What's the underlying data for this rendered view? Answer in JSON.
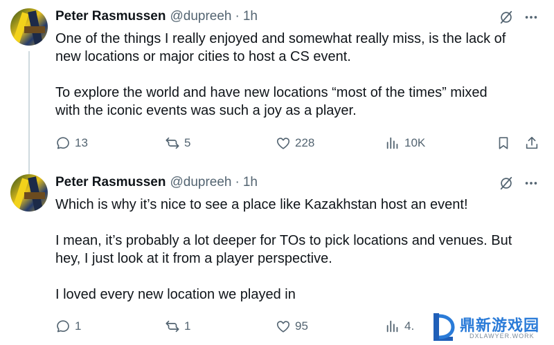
{
  "tweets": [
    {
      "name": "Peter Rasmussen",
      "handle": "@dupreeh",
      "separator": "·",
      "time": "1h",
      "lines": [
        "One of the things I really enjoyed and somewhat really miss, is the lack of",
        "new locations or major cities to host a CS event.",
        "",
        "To explore the world and have new locations “most of the times” mixed",
        "with the iconic events was such a joy as a player."
      ],
      "replies": "13",
      "reposts": "5",
      "likes": "228",
      "views": "10K"
    },
    {
      "name": "Peter Rasmussen",
      "handle": "@dupreeh",
      "separator": "·",
      "time": "1h",
      "lines": [
        "Which is why it’s nice to see a place like Kazakhstan host an event!",
        "",
        "I mean, it’s probably a lot deeper for TOs to pick locations and venues. But",
        "hey, I just look at it from a player perspective.",
        "",
        "I loved every new location we played in"
      ],
      "replies": "1",
      "reposts": "1",
      "likes": "95",
      "views": "4."
    }
  ],
  "icons": {
    "reply": "reply-icon",
    "repost": "repost-icon",
    "like": "heart-icon",
    "views": "views-icon",
    "bookmark": "bookmark-icon",
    "share": "share-icon",
    "grok": "grok-icon",
    "more": "more-icon"
  },
  "colors": {
    "text": "#0f1419",
    "muted": "#536471",
    "thread_line": "#cfd9de",
    "watermark_blue": "#2a7bd8"
  },
  "watermark": {
    "text_cn": "鼎新游戏园",
    "text_en": "DXLAWYER.WORK"
  }
}
